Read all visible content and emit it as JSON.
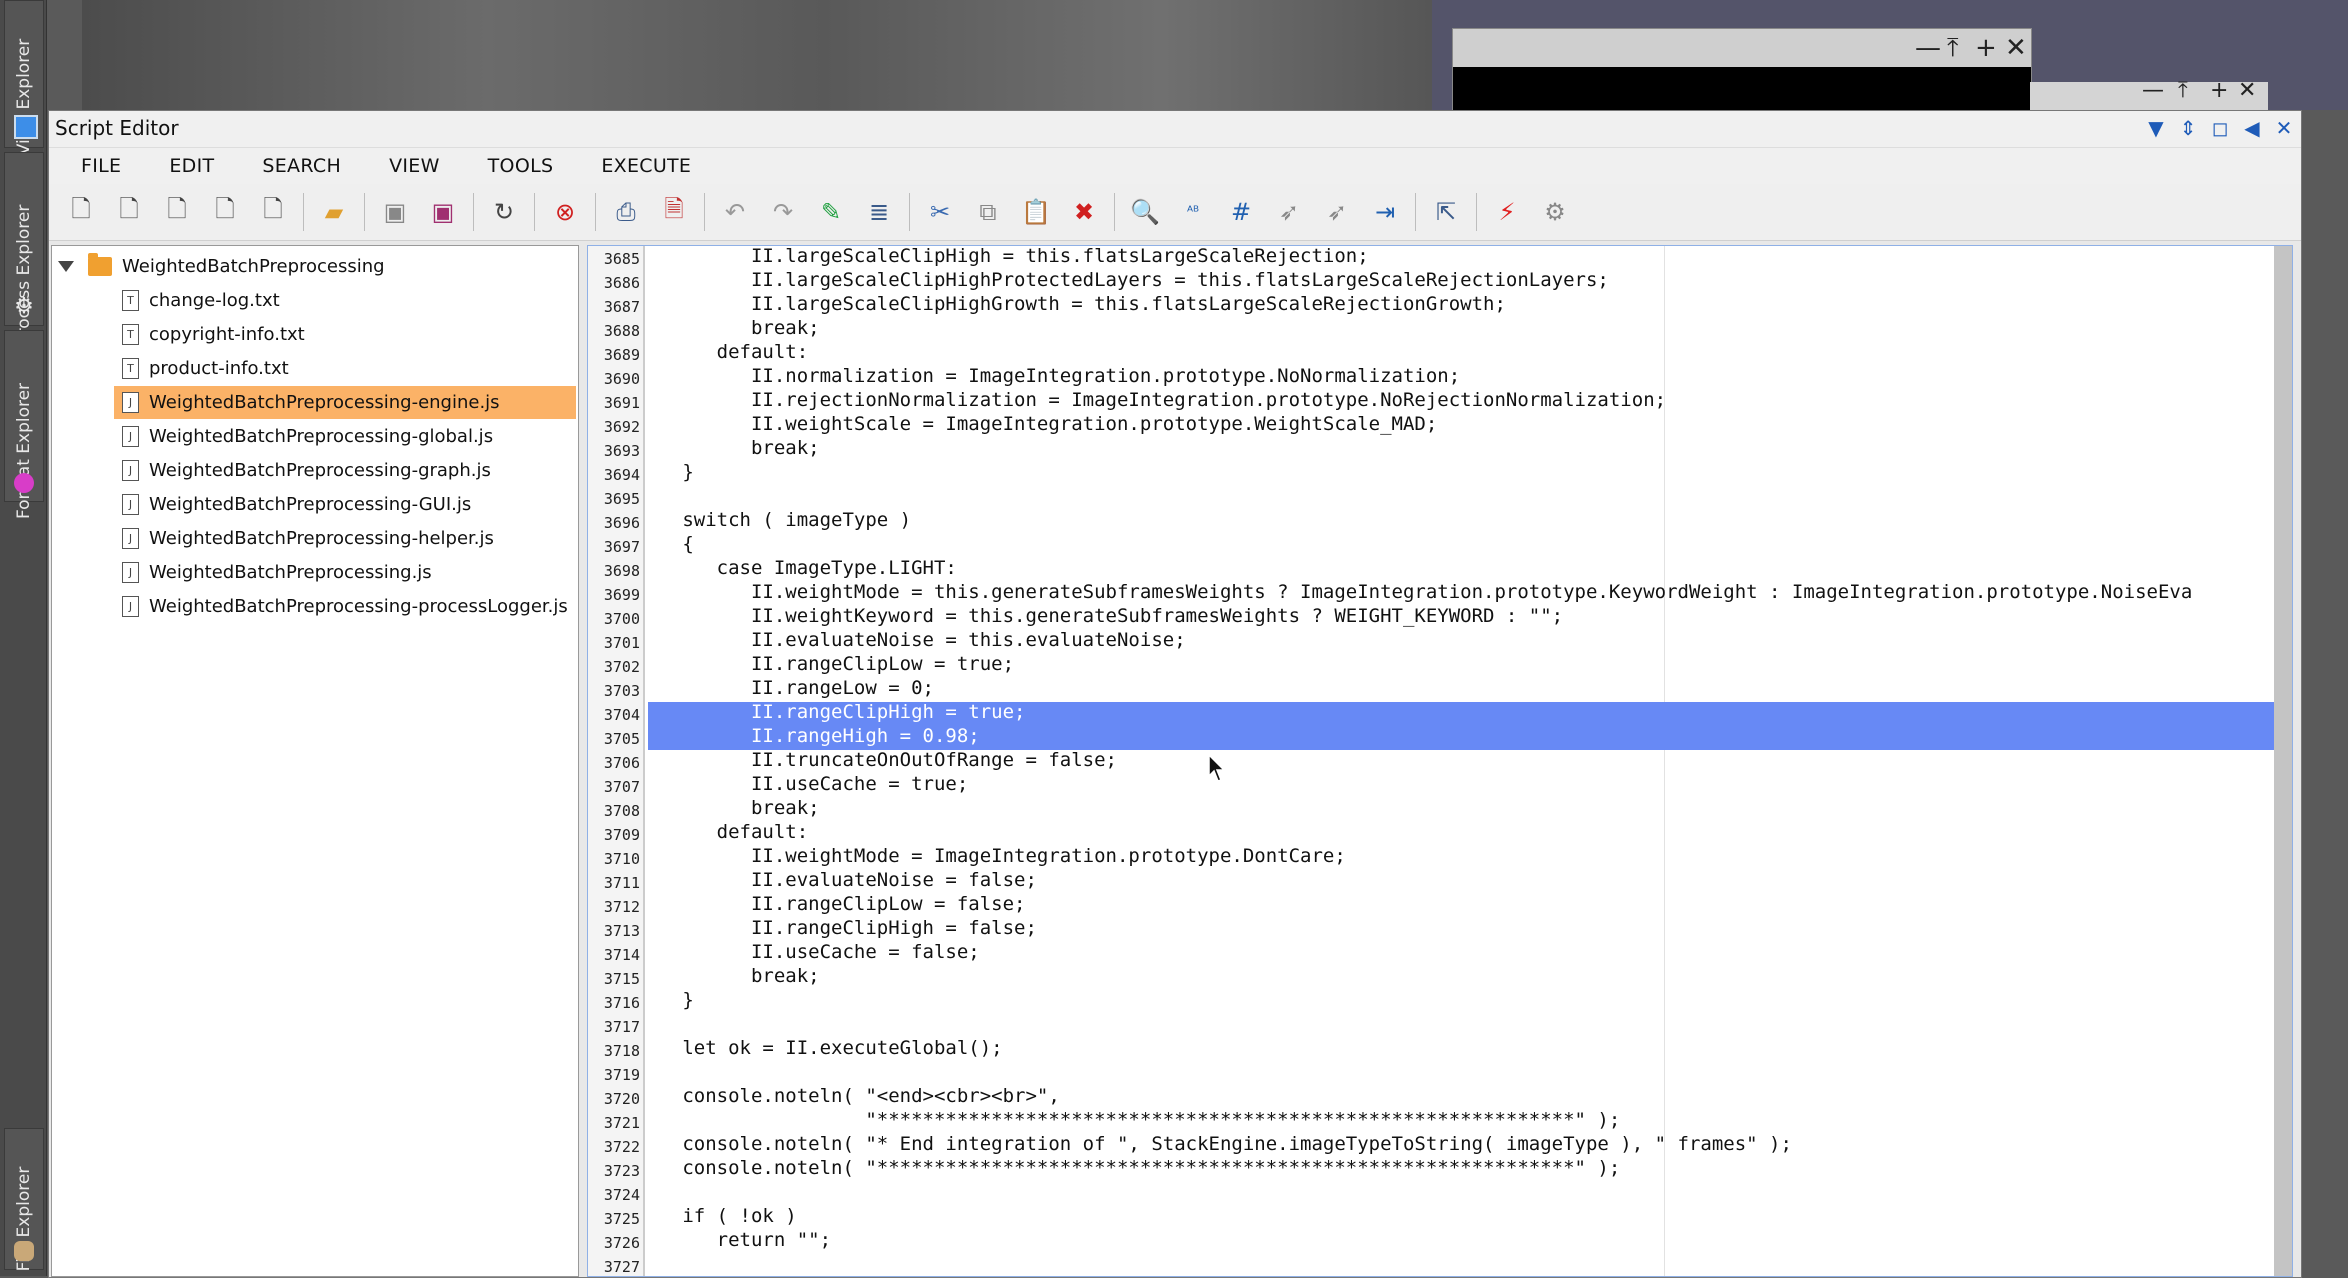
{
  "background": {
    "window_buttons": [
      "—",
      "⤒",
      "+",
      "✕"
    ]
  },
  "dock": {
    "tabs": [
      {
        "label": "View Explorer",
        "icon": "view-explorer-icon"
      },
      {
        "label": "Process Explorer",
        "icon": "gear-icon"
      },
      {
        "label": "Format Explorer",
        "icon": "format-explorer-icon"
      },
      {
        "label": "File Explorer",
        "icon": "database-icon"
      }
    ]
  },
  "editor": {
    "title": "Script Editor",
    "menu": [
      "FILE",
      "EDIT",
      "SEARCH",
      "VIEW",
      "TOOLS",
      "EXECUTE"
    ],
    "toolbar": [
      "new-js-icon",
      "new-jsh-icon",
      "new-c-icon",
      "new-h-icon",
      "new-file-icon",
      "open-folder-icon",
      "save-icon",
      "save-all-icon",
      "reload-icon",
      "close-icon",
      "print-icon",
      "export-pdf-icon",
      "undo-icon",
      "redo-icon",
      "pencil-icon",
      "align-icon",
      "cut-icon",
      "copy-icon",
      "paste-icon",
      "delete-icon",
      "search-icon",
      "spellcheck-icon",
      "goto-line-icon",
      "bookmark-icon",
      "bookmark-next-icon",
      "jump-icon",
      "indent-icon",
      "execute-icon",
      "settings-icon"
    ],
    "accent": "#1e5bb8"
  },
  "tree": {
    "root": "WeightedBatchPreprocessing",
    "files": [
      {
        "name": "change-log.txt",
        "icon": "T",
        "selected": false
      },
      {
        "name": "copyright-info.txt",
        "icon": "T",
        "selected": false
      },
      {
        "name": "product-info.txt",
        "icon": "T",
        "selected": false
      },
      {
        "name": "WeightedBatchPreprocessing-engine.js",
        "icon": "J",
        "selected": true
      },
      {
        "name": "WeightedBatchPreprocessing-global.js",
        "icon": "J",
        "selected": false
      },
      {
        "name": "WeightedBatchPreprocessing-graph.js",
        "icon": "J",
        "selected": false
      },
      {
        "name": "WeightedBatchPreprocessing-GUI.js",
        "icon": "J",
        "selected": false
      },
      {
        "name": "WeightedBatchPreprocessing-helper.js",
        "icon": "J",
        "selected": false
      },
      {
        "name": "WeightedBatchPreprocessing.js",
        "icon": "J",
        "selected": false
      },
      {
        "name": "WeightedBatchPreprocessing-processLogger.js",
        "icon": "J",
        "selected": false
      }
    ]
  },
  "code": {
    "selection_color": "#6789f5",
    "lines": [
      {
        "n": "3685",
        "text": "         II.largeScaleClipHigh = this.flatsLargeScaleRejection;"
      },
      {
        "n": "3686",
        "text": "         II.largeScaleClipHighProtectedLayers = this.flatsLargeScaleRejectionLayers;"
      },
      {
        "n": "3687",
        "text": "         II.largeScaleClipHighGrowth = this.flatsLargeScaleRejectionGrowth;"
      },
      {
        "n": "3688",
        "text": "         break;"
      },
      {
        "n": "3689",
        "text": "      default:"
      },
      {
        "n": "3690",
        "text": "         II.normalization = ImageIntegration.prototype.NoNormalization;"
      },
      {
        "n": "3691",
        "text": "         II.rejectionNormalization = ImageIntegration.prototype.NoRejectionNormalization;"
      },
      {
        "n": "3692",
        "text": "         II.weightScale = ImageIntegration.prototype.WeightScale_MAD;"
      },
      {
        "n": "3693",
        "text": "         break;"
      },
      {
        "n": "3694",
        "text": "   }"
      },
      {
        "n": "3695",
        "text": ""
      },
      {
        "n": "3696",
        "text": "   switch ( imageType )"
      },
      {
        "n": "3697",
        "text": "   {"
      },
      {
        "n": "3698",
        "text": "      case ImageType.LIGHT:"
      },
      {
        "n": "3699",
        "text": "         II.weightMode = this.generateSubframesWeights ? ImageIntegration.prototype.KeywordWeight : ImageIntegration.prototype.NoiseEva"
      },
      {
        "n": "3700",
        "text": "         II.weightKeyword = this.generateSubframesWeights ? WEIGHT_KEYWORD : \"\";"
      },
      {
        "n": "3701",
        "text": "         II.evaluateNoise = this.evaluateNoise;"
      },
      {
        "n": "3702",
        "text": "         II.rangeClipLow = true;"
      },
      {
        "n": "3703",
        "text": "         II.rangeLow = 0;"
      },
      {
        "n": "3704",
        "text": "         II.rangeClipHigh = true;"
      },
      {
        "n": "3705",
        "text": "         II.rangeHigh = 0.98;"
      },
      {
        "n": "3706",
        "text": "         II.truncateOnOutOfRange = false;"
      },
      {
        "n": "3707",
        "text": "         II.useCache = true;"
      },
      {
        "n": "3708",
        "text": "         break;"
      },
      {
        "n": "3709",
        "text": "      default:"
      },
      {
        "n": "3710",
        "text": "         II.weightMode = ImageIntegration.prototype.DontCare;"
      },
      {
        "n": "3711",
        "text": "         II.evaluateNoise = false;"
      },
      {
        "n": "3712",
        "text": "         II.rangeClipLow = false;"
      },
      {
        "n": "3713",
        "text": "         II.rangeClipHigh = false;"
      },
      {
        "n": "3714",
        "text": "         II.useCache = false;"
      },
      {
        "n": "3715",
        "text": "         break;"
      },
      {
        "n": "3716",
        "text": "   }"
      },
      {
        "n": "3717",
        "text": ""
      },
      {
        "n": "3718",
        "text": "   let ok = II.executeGlobal();"
      },
      {
        "n": "3719",
        "text": ""
      },
      {
        "n": "3720",
        "text": "   console.noteln( \"<end><cbr><br>\","
      },
      {
        "n": "3721",
        "text": "                   \"*************************************************************\" );"
      },
      {
        "n": "3722",
        "text": "   console.noteln( \"* End integration of \", StackEngine.imageTypeToString( imageType ), \" frames\" );"
      },
      {
        "n": "3723",
        "text": "   console.noteln( \"*************************************************************\" );"
      },
      {
        "n": "3724",
        "text": ""
      },
      {
        "n": "3725",
        "text": "   if ( !ok )"
      },
      {
        "n": "3726",
        "text": "      return \"\";"
      },
      {
        "n": "3727",
        "text": ""
      }
    ]
  }
}
